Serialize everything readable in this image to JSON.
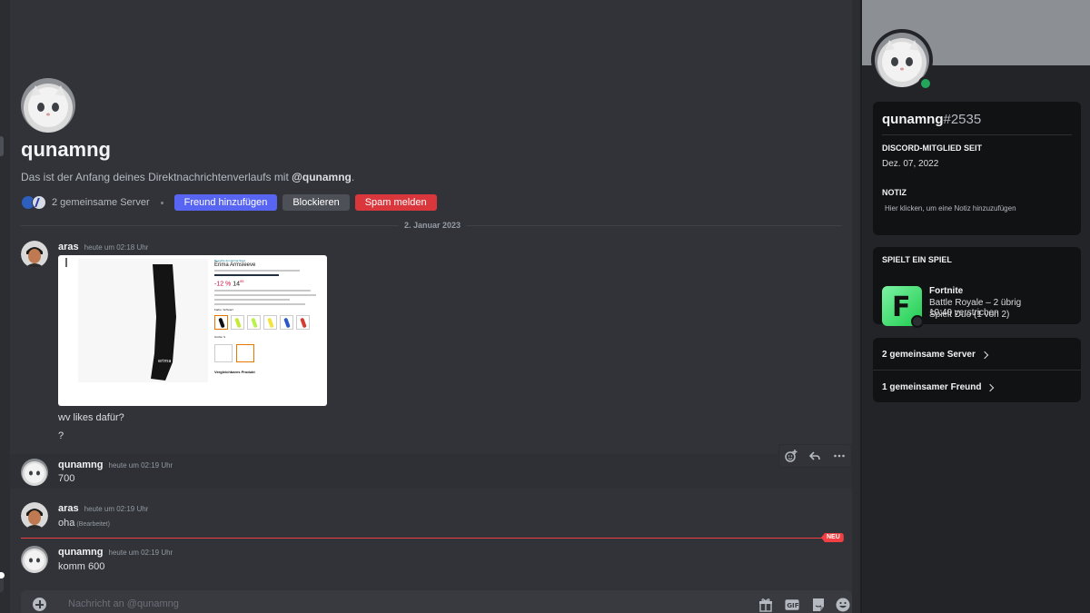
{
  "intro": {
    "username": "qunamng",
    "text_prefix": "Das ist der Anfang deines Direktnachrichtenverlaufs mit ",
    "text_mention": "@qunamng",
    "text_suffix": ".",
    "mutual_servers": "2 gemeinsame Server",
    "add_friend": "Freund hinzufügen",
    "block": "Blockieren",
    "report_spam": "Spam melden"
  },
  "date_divider": "2. Januar 2023",
  "messages": [
    {
      "author": "aras",
      "timestamp": "heute um 02:18 Uhr",
      "lines": [
        "wv likes dafür?",
        "?"
      ],
      "has_attachment": true
    },
    {
      "author": "qunamng",
      "timestamp": "heute um 02:19 Uhr",
      "lines": [
        "700"
      ]
    },
    {
      "author": "aras",
      "timestamp": "heute um 02:19 Uhr",
      "lines": [
        "oha"
      ],
      "edited": "(Bearbeitet)"
    },
    {
      "author": "qunamng",
      "timestamp": "heute um 02:19 Uhr",
      "lines": [
        "komm 600"
      ]
    }
  ],
  "attachment": {
    "store_link": "Besuche den Erima-Store",
    "product_title": "Erima Armsleeve",
    "discount": "-12 %",
    "price": "14",
    "price_cents": "95",
    "color_label": "Farbe: Schwarz",
    "size_label": "Größe: S",
    "compare_heading": "Vergleichbares Produkt",
    "swatch_colors": [
      "#111111",
      "#c6e83a",
      "#b9f24a",
      "#f2e43a",
      "#2a58c9",
      "#d63b2f"
    ]
  },
  "new_divider_label": "NEU",
  "composer": {
    "placeholder": "Nachricht an @qunamng"
  },
  "profile": {
    "username": "qunamng",
    "discriminator": "#2535",
    "member_since_heading": "DISCORD-MITGLIED SEIT",
    "member_since": "Dez. 07, 2022",
    "note_heading": "NOTIZ",
    "note_placeholder": "Hier klicken, um eine Notiz hinzuzufügen",
    "status_color": "#23a55a"
  },
  "activity": {
    "heading": "SPIELT EIN SPIEL",
    "game": "Fortnite",
    "details": "Battle Royale – 2 übrig",
    "state": "Spielt Duo (1 von 2)",
    "elapsed": "10:40 verstrichen",
    "icon_letter": "F"
  },
  "mutuals": {
    "servers": "2 gemeinsame Server",
    "friends": "1 gemeinsamer Freund"
  },
  "colors": {
    "accent": "#5865f2",
    "danger": "#da373c",
    "new_divider": "#f23f43"
  }
}
